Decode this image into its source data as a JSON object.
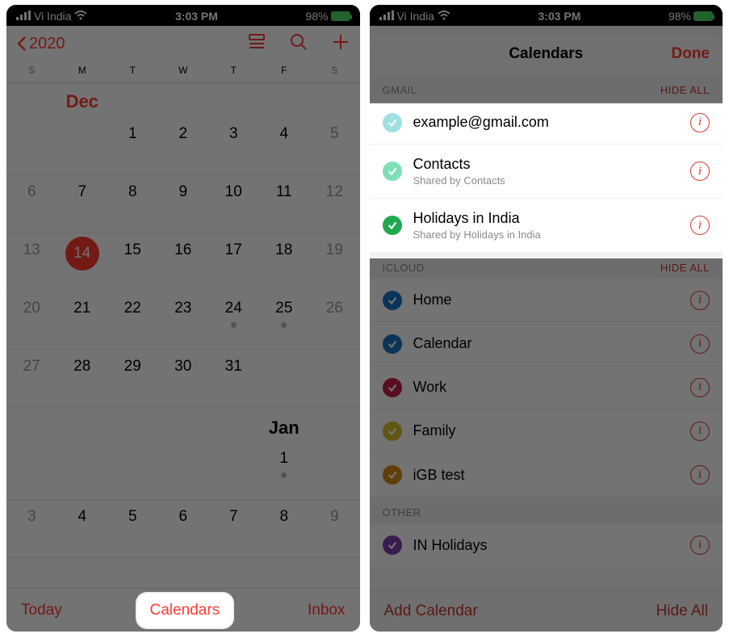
{
  "status_bar": {
    "carrier": "Vi India",
    "time": "3:03 PM",
    "battery": "98%"
  },
  "left": {
    "nav": {
      "back_label": "2020"
    },
    "weekdays": [
      "S",
      "M",
      "T",
      "W",
      "T",
      "F",
      "S"
    ],
    "month_label": "Dec",
    "today": 14,
    "rows": [
      [
        null,
        null,
        1,
        2,
        3,
        4,
        5
      ],
      [
        6,
        7,
        8,
        9,
        10,
        11,
        12
      ],
      [
        13,
        14,
        15,
        16,
        17,
        18,
        19
      ],
      [
        20,
        21,
        22,
        23,
        24,
        25,
        26
      ],
      [
        27,
        28,
        29,
        30,
        31,
        null,
        null
      ]
    ],
    "event_dots": [
      24,
      25
    ],
    "jan_label": "Jan",
    "jan_rows": [
      [
        null,
        null,
        null,
        null,
        null,
        1,
        null
      ],
      [
        3,
        4,
        5,
        6,
        7,
        8,
        9
      ]
    ],
    "jan_event_dots": [
      1
    ],
    "toolbar": {
      "today": "Today",
      "calendars": "Calendars",
      "inbox": "Inbox"
    }
  },
  "right": {
    "sheet_title": "Calendars",
    "done_label": "Done",
    "sections": [
      {
        "name": "GMAIL",
        "hide_label": "HIDE ALL",
        "items": [
          {
            "title": "example@gmail.com",
            "subtitle": null,
            "color": "#9fe1e1"
          },
          {
            "title": "Contacts",
            "subtitle": "Shared by Contacts",
            "color": "#7fe0b7"
          },
          {
            "title": "Holidays in India",
            "subtitle": "Shared by Holidays in India",
            "color": "#1fa951"
          }
        ]
      },
      {
        "name": "ICLOUD",
        "hide_label": "HIDE ALL",
        "items": [
          {
            "title": "Home",
            "subtitle": null,
            "color": "#1a74c4"
          },
          {
            "title": "Calendar",
            "subtitle": null,
            "color": "#1a74c4"
          },
          {
            "title": "Work",
            "subtitle": null,
            "color": "#c21f4a"
          },
          {
            "title": "Family",
            "subtitle": null,
            "color": "#d8c02a"
          },
          {
            "title": "iGB test",
            "subtitle": null,
            "color": "#d88b1a"
          }
        ]
      },
      {
        "name": "OTHER",
        "hide_label": null,
        "items": [
          {
            "title": "IN Holidays",
            "subtitle": null,
            "color": "#7a3fae"
          }
        ]
      }
    ],
    "toolbar": {
      "add": "Add Calendar",
      "hide_all": "Hide All"
    }
  }
}
